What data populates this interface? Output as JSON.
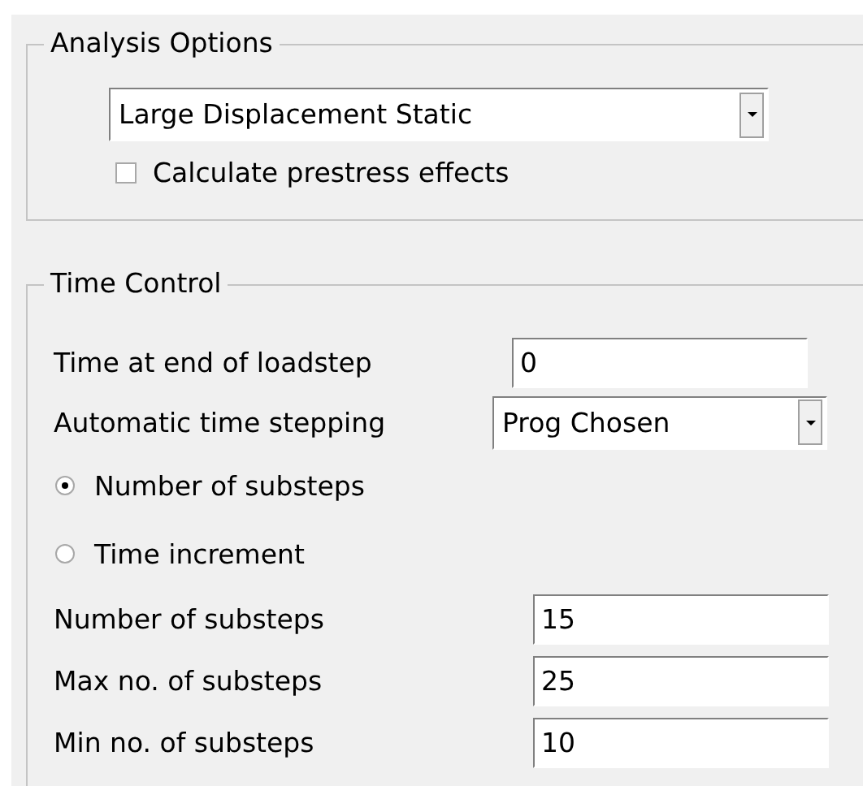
{
  "analysis_options": {
    "title": "Analysis Options",
    "analysis_type": {
      "value": "Large Displacement Static"
    },
    "prestress": {
      "label": "Calculate prestress effects",
      "checked": false
    }
  },
  "time_control": {
    "title": "Time Control",
    "rows": [
      {
        "kind": "field",
        "label": "Time at end of loadstep",
        "value": "0"
      },
      {
        "kind": "dropdown",
        "label": "Automatic time stepping",
        "value": "Prog Chosen"
      },
      {
        "kind": "radio",
        "label": "Number of substeps",
        "selected": true
      },
      {
        "kind": "radio",
        "label": "Time increment",
        "selected": false
      },
      {
        "kind": "field",
        "label": "Number of substeps",
        "value": "15"
      },
      {
        "kind": "field",
        "label": "Max no. of substeps",
        "value": "25"
      },
      {
        "kind": "field",
        "label": "Min no. of substeps",
        "value": "10"
      }
    ]
  }
}
